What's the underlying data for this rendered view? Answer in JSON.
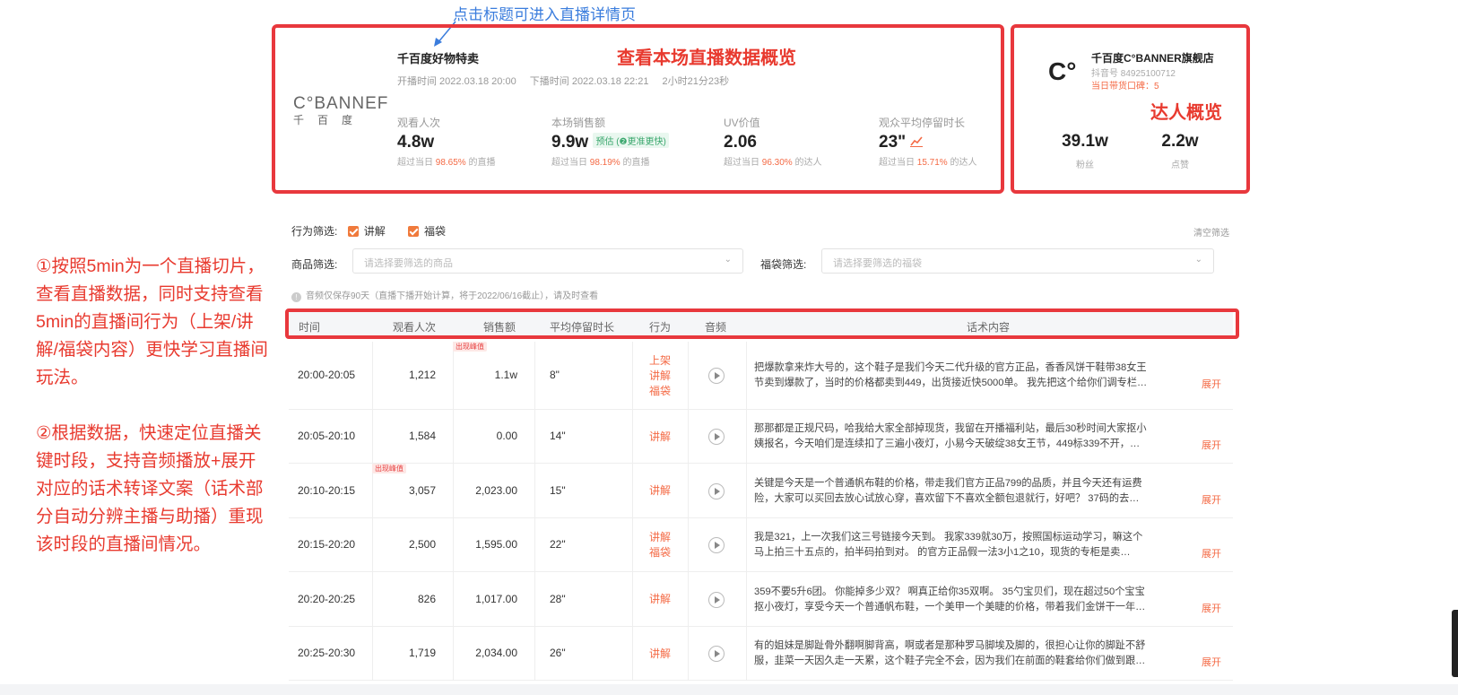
{
  "annotations": {
    "top_note": "点击标题可进入直播详情页",
    "overview_note": "查看本场直播数据概览",
    "streamer_note": "达人概览",
    "side_note_1": "①按照5min为一个直播切片，查看直播数据，同时支持查看5min的直播间行为（上架/讲解/福袋内容）更快学习直播间玩法。",
    "side_note_2": "②根据数据，快速定位直播关键时段，支持音频播放+展开对应的话术转译文案（话术部分自动分辨主播与助播）重现该时段的直播间情况。"
  },
  "live": {
    "logo_line1": "C°BANNEF",
    "logo_line2": "千百度",
    "title": "千百度好物特卖",
    "start_time": "开播时间  2022.03.18 20:00",
    "end_time": "下播时间  2022.03.18 22:21",
    "duration": "2小时21分23秒",
    "metrics": [
      {
        "label": "观看人次",
        "value": "4.8w",
        "sub_prefix": "超过当日",
        "sub_pct": "98.65%",
        "sub_suffix": "的直播"
      },
      {
        "label": "本场销售额",
        "value": "9.9w",
        "tag": "预估 (❷更准更快)",
        "sub_prefix": "超过当日",
        "sub_pct": "98.19%",
        "sub_suffix": "的直播"
      },
      {
        "label": "UV价值",
        "value": "2.06",
        "sub_prefix": "超过当日",
        "sub_pct": "96.30%",
        "sub_suffix": "的达人"
      },
      {
        "label": "观众平均停留时长",
        "value": "23\"",
        "sub_prefix": "超过当日",
        "sub_pct": "15.71%",
        "sub_suffix": "的达人"
      }
    ]
  },
  "streamer": {
    "logo": "C°",
    "name": "千百度C°BANNER旗舰店",
    "id": "抖音号 84925100712",
    "rate": "当日带货口碑：5",
    "fans_value": "39.1w",
    "fans_label": "粉丝",
    "likes_value": "2.2w",
    "likes_label": "点赞"
  },
  "filters": {
    "behavior_label": "行为筛选:",
    "opt_explain": "讲解",
    "opt_bag": "福袋",
    "clear": "清空筛选",
    "product_label": "商品筛选:",
    "product_placeholder": "请选择要筛选的商品",
    "bag_label": "福袋筛选:",
    "bag_placeholder": "请选择要筛选的福袋",
    "notice": "音频仅保存90天（直播下播开始计算，将于2022/06/16截止），请及时查看"
  },
  "table": {
    "headers": [
      "时间",
      "观看人次",
      "销售额",
      "平均停留时长",
      "行为",
      "音频",
      "话术内容"
    ],
    "peak_label": "出现峰值",
    "expand_label": "展开",
    "rows": [
      {
        "time": "20:00-20:05",
        "views": "1,212",
        "sales": "1.1w",
        "stay": "8\"",
        "actions": [
          "上架",
          "讲解",
          "福袋"
        ],
        "line1": "把爆款拿来炸大号的，这个鞋子是我们今天二代升级的官方正品，香香风饼干鞋带38女王",
        "line2": "节卖到爆款了，当时的价格都卖到449，出货接近快5000单。 我先把这个给你们调专栏…"
      },
      {
        "time": "20:05-20:10",
        "views": "1,584",
        "sales": "0.00",
        "stay": "14\"",
        "actions": [
          "讲解"
        ],
        "line1": "那那都是正规尺码，哈我给大家全部掉现货，我留在开播福利站，最后30秒时间大家抠小",
        "line2": "姨报名，今天咱们是连续扣了三遍小夜灯，小易今天破绽38女王节，449标339不开，…"
      },
      {
        "time": "20:10-20:15",
        "views": "3,057",
        "sales": "2,023.00",
        "stay": "15\"",
        "actions": [
          "讲解"
        ],
        "line1": "关键是今天是一个普通帆布鞋的价格，带走我们官方正品799的品质，并且今天还有运费",
        "line2": "险，大家可以买回去放心试放心穿，喜欢留下不喜欢全额包退就行，好吧？ 37码的去…"
      },
      {
        "time": "20:15-20:20",
        "views": "2,500",
        "sales": "1,595.00",
        "stay": "22\"",
        "actions": [
          "讲解",
          "福袋"
        ],
        "line1": "我是321，上一次我们这三号链接今天到。 我家339就30万，按照国标运动学习，嘛这个",
        "line2": "马上拍三十五点的，拍半码拍到对。 的官方正品假一法3小1之10，现货的专柜是卖…"
      },
      {
        "time": "20:20-20:25",
        "views": "826",
        "sales": "1,017.00",
        "stay": "28\"",
        "actions": [
          "讲解"
        ],
        "line1": "359不要5升6团。 你能掉多少双？ 啊真正给你35双啊。 35勺宝贝们，现在超过50个宝宝",
        "line2": "抠小夜灯，享受今天一个普通帆布鞋，一个美甲一个美睫的价格，带着我们金饼干一年…"
      },
      {
        "time": "20:25-20:30",
        "views": "1,719",
        "sales": "2,034.00",
        "stay": "26\"",
        "actions": [
          "讲解"
        ],
        "line1": "有的姐妹是脚趾骨外翻啊脚背高，啊或者是那种罗马脚埃及脚的，很担心让你的脚趾不舒",
        "line2": "服，韭菜一天因久走一天累，这个鞋子完全不会，因为我们在前面的鞋套给你们做到跟…"
      }
    ]
  },
  "colors": {
    "frame_red": "#e8383d",
    "accent_orange": "#f46a45",
    "note_blue": "#3b7ddd"
  }
}
